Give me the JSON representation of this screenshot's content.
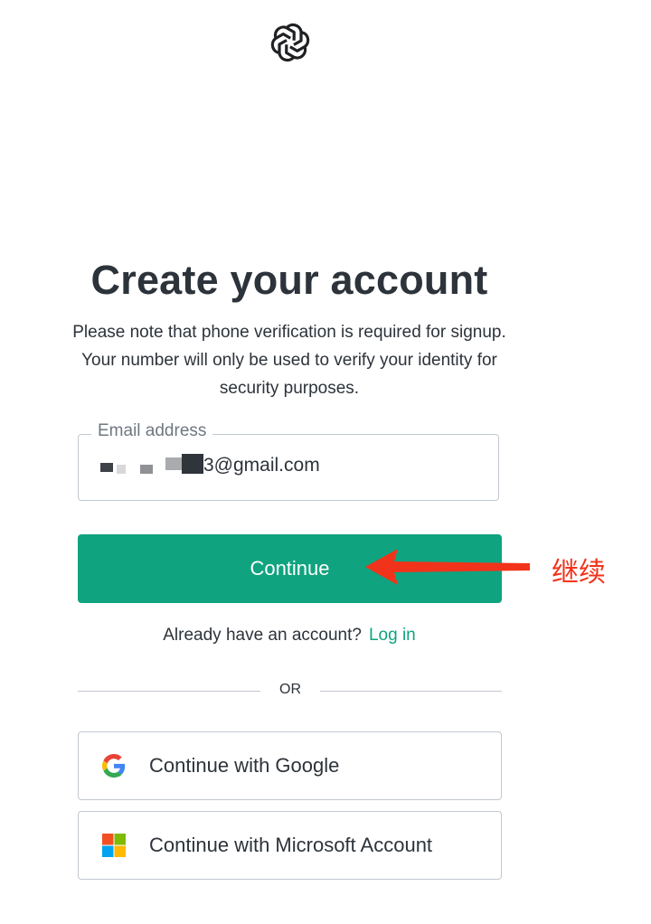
{
  "header": {
    "logo_icon": "openai-logo-icon"
  },
  "main": {
    "title": "Create your account",
    "subtitle": "Please note that phone verification is required for signup. Your number will only be used to verify your identity for security purposes.",
    "email_field": {
      "label": "Email address",
      "value_visible_suffix": "3@gmail.com"
    },
    "continue_label": "Continue",
    "login_prompt": "Already have an account?",
    "login_link": "Log in",
    "divider_text": "OR",
    "social": [
      {
        "label": "Continue with Google",
        "icon": "google-icon"
      },
      {
        "label": "Continue with Microsoft Account",
        "icon": "microsoft-icon"
      }
    ]
  },
  "annotation": {
    "text": "继续",
    "arrow_icon": "red-arrow-icon",
    "color": "#f2331b"
  },
  "colors": {
    "accent": "#10a37f",
    "text": "#2d333a",
    "border": "#c2c8d0"
  }
}
